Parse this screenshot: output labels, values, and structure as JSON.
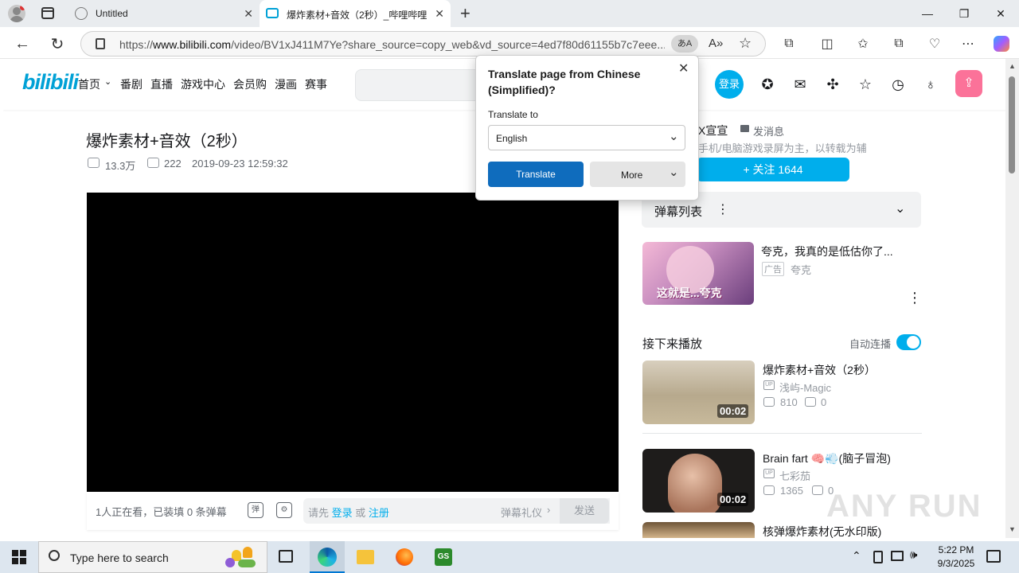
{
  "browser": {
    "tabs": [
      {
        "title": "Untitled"
      },
      {
        "title": "爆炸素材+音效（2秒）_哔哩哔哩"
      }
    ],
    "url_prefix": "https://",
    "url_domain": "www.bilibili.com",
    "url_rest": "/video/BV1xJ411M7Ye?share_source=copy_web&vd_source=4ed7f80d61155b7c7eee...",
    "translate_badge": "あA"
  },
  "bili": {
    "logo": "bilibili",
    "nav": [
      "首页",
      "番剧",
      "直播",
      "游戏中心",
      "会员购",
      "漫画",
      "赛事"
    ],
    "login": "登录"
  },
  "video": {
    "title": "爆炸素材+音效（2秒）",
    "views": "13.3万",
    "danmaku": "222",
    "date": "2019-09-23 12:59:32",
    "watching": "1人正在看，已装填 0 条弹幕",
    "please_first": "请先",
    "login_link": "登录",
    "or": "或",
    "register_link": "注册",
    "etiquette": "弹幕礼仪",
    "send": "发送"
  },
  "uploader": {
    "name": "X宣宣",
    "message": "发消息",
    "desc": "手机/电脑游戏录屏为主，以转载为辅",
    "follow": "+ 关注 1644"
  },
  "danmaku_list": "弹幕列表",
  "ad": {
    "title": "夸克，我真的是低估你了...",
    "badge": "广告",
    "source": "夸克",
    "thumb_text": "这就是...夸克"
  },
  "up_next": {
    "label": "接下来播放",
    "autoplay": "自动连播",
    "items": [
      {
        "title": "爆炸素材+音效（2秒）",
        "author": "浅屿-Magic",
        "views": "810",
        "comments": "0",
        "duration": "00:02"
      },
      {
        "title": "Brain fart 🧠💨(脑子冒泡)",
        "author": "七彩茄",
        "views": "1365",
        "comments": "0",
        "duration": "00:02"
      },
      {
        "title": "核弹爆炸素材(无水印版)"
      }
    ]
  },
  "translate_popup": {
    "title": "Translate page from Chinese (Simplified)?",
    "to_label": "Translate to",
    "language": "English",
    "translate_btn": "Translate",
    "more_btn": "More"
  },
  "taskbar": {
    "search_placeholder": "Type here to search",
    "time": "5:22 PM",
    "date": "9/3/2025"
  },
  "watermark": "ANY RUN"
}
